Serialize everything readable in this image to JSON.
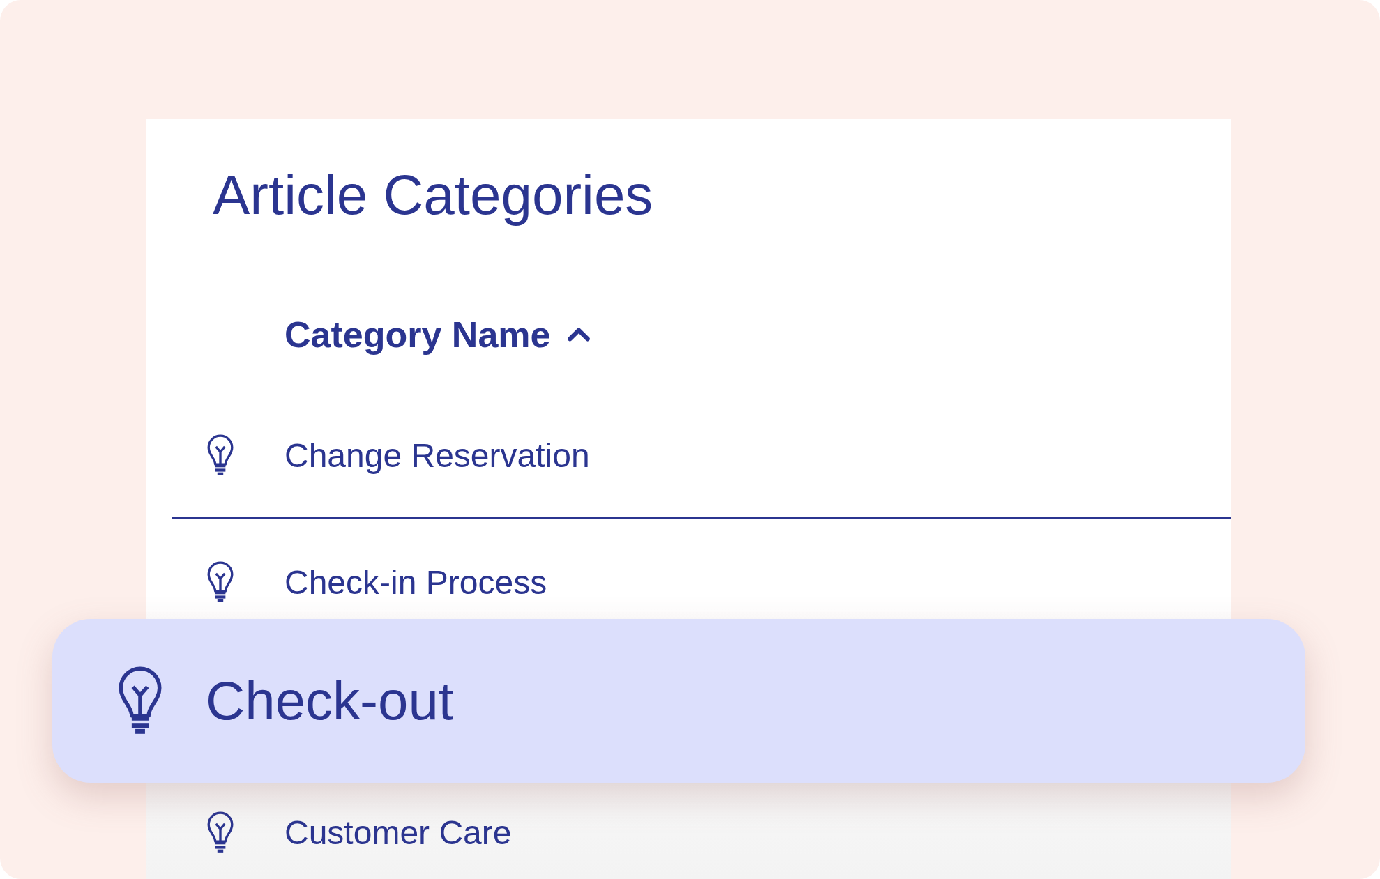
{
  "title": "Article Categories",
  "column": {
    "label": "Category Name",
    "sort_ascending": true
  },
  "rows": [
    {
      "label": "Change Reservation",
      "selected": false,
      "focused": true
    },
    {
      "label": "Check-in Process",
      "selected": false,
      "focused": false
    },
    {
      "label": "Check-out",
      "selected": true,
      "focused": false
    },
    {
      "label": "Customer Care",
      "selected": false,
      "focused": false
    }
  ]
}
